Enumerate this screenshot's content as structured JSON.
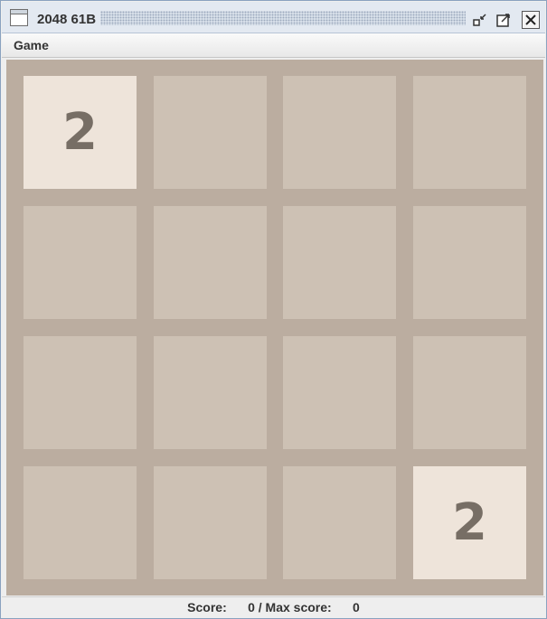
{
  "window": {
    "title": "2048 61B"
  },
  "title_buttons": {
    "minimize_icon": "minimize-icon",
    "maximize_icon": "maximize-icon",
    "close_icon": "close-icon"
  },
  "menu": {
    "items": [
      {
        "label": "Game"
      }
    ]
  },
  "board": {
    "size": 4,
    "tiles": [
      [
        "2",
        "",
        "",
        ""
      ],
      [
        "",
        "",
        "",
        ""
      ],
      [
        "",
        "",
        "",
        ""
      ],
      [
        "",
        "",
        "",
        "2"
      ]
    ],
    "colors": {
      "board_bg": "#bbada0",
      "empty_tile": "#cdc1b4",
      "tile_2": "#eee4da",
      "tile_text": "#776e65"
    }
  },
  "status": {
    "score_label": "Score:",
    "score": "0",
    "max_score_label": "Max score:",
    "max_score": "0",
    "text": "Score:      0 / Max score:      0"
  }
}
